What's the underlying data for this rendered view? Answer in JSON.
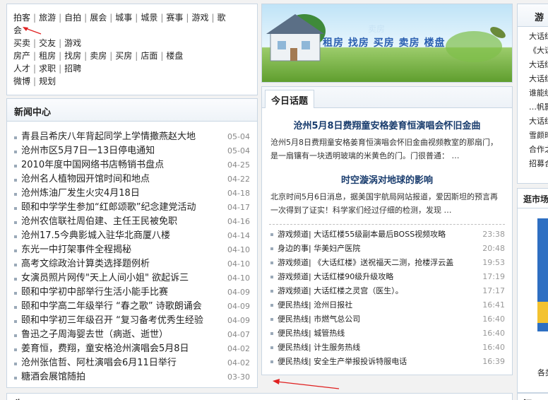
{
  "categories": {
    "row1": [
      "拍客",
      "旅游",
      "自拍",
      "展会",
      "城事",
      "城景",
      "赛事",
      "游戏",
      "歌"
    ],
    "row1b": [
      "会"
    ],
    "row2": [
      "买卖",
      "交友",
      "游戏"
    ],
    "row3": [
      "房产",
      "租房",
      "找房",
      "卖房",
      "买房",
      "店面",
      "楼盘"
    ],
    "row4": [
      "人才",
      "求职",
      "招聘"
    ],
    "row5": [
      "微博",
      "规划"
    ]
  },
  "news": {
    "title": "新闻中心",
    "items": [
      {
        "text": "青县吕希庆八年背起同学上学情撒燕赵大地",
        "date": "05-04"
      },
      {
        "text": "沧州市区5月7日一13日停电通知",
        "date": "05-04"
      },
      {
        "text": "2010年度中国网络书店畅销书盘点",
        "date": "04-25"
      },
      {
        "text": "沧州名人植物园开馆时间和地点",
        "date": "04-22"
      },
      {
        "text": "沧州炼油厂发生火灾4月18日",
        "date": "04-18"
      },
      {
        "text": "颐和中学学生参加“红郎颂歌”纪念建党活动",
        "date": "04-17"
      },
      {
        "text": "沧州农信联社周伯建、主任王民被免职",
        "date": "04-16"
      },
      {
        "text": "沧州17.5今典影城入驻华北商厦八楼",
        "date": "04-14"
      },
      {
        "text": "东光一中打架事件全程揭秘",
        "date": "04-10"
      },
      {
        "text": "高考文综政治计算类选择题例析",
        "date": "04-10"
      },
      {
        "text": "女演员照片网传\"天上人间小姐\" 欲起诉三",
        "date": "04-10"
      },
      {
        "text": "颐和中学初中部举行生活小能手比赛",
        "date": "04-09"
      },
      {
        "text": "颐和中学高二年级举行 “春之歌” 诗歌朗诵会",
        "date": "04-09"
      },
      {
        "text": "颐和中学初三年级召开 “复习备考优秀生经验",
        "date": "04-09"
      },
      {
        "text": "鲁迅之子周海婴去世（病逝、逝世）",
        "date": "04-07"
      },
      {
        "text": "姜育恒，费翔，童安格沧州演唱会5月8日",
        "date": "04-02"
      },
      {
        "text": "沧州张信哲、阿杜演唱会6月11日举行",
        "date": "04-02"
      },
      {
        "text": "糖酒会展馆随拍",
        "date": "03-30"
      }
    ]
  },
  "banner": {
    "text": "租房 找房 买房 卖房 楼盘",
    "sub": "卖房"
  },
  "today": {
    "tab": "今日话题",
    "story1_title": "沧州5月8日费翔童安格姜育恒演唱会怀旧金曲",
    "story1_body": "沧州5月8日费翔童安格姜育恒演唱会怀旧金曲视频教室的那扇门，是一扇镶有一块透明玻璃的米黄色的门。门很普通：  …",
    "story2_title": "时空漩涡对地球的影响",
    "story2_body": "北京时间5月6日消息，据美国宇航局网站报道，爱因斯坦的预言再一次得到了证实！科学家们经过仔细的检测，发现  …",
    "items": [
      {
        "text": "游戏频道| 大话红楼55级副本最后BOSS视频攻略",
        "time": "23:38"
      },
      {
        "text": "身边的事| 华美妇产医院",
        "time": "20:48"
      },
      {
        "text": "游戏频道| 《大话红楼》送祝福天二测，抢楼浮云盖",
        "time": "19:53"
      },
      {
        "text": "游戏频道| 大话红楼90级升级攻略",
        "time": "17:19"
      },
      {
        "text": "游戏频道| 大话红楼之灵宫（医生）。",
        "time": "17:17"
      },
      {
        "text": "便民热线| 沧州日报社",
        "time": "16:41"
      },
      {
        "text": "便民热线| 市燃气总公司",
        "time": "16:40"
      },
      {
        "text": "便民热线| 城管热线",
        "time": "16:40"
      },
      {
        "text": "便民热线| 计生服务热线",
        "time": "16:40"
      },
      {
        "text": "便民热线| 安全生产举报投诉特服电话",
        "time": "16:39"
      }
    ]
  },
  "right": {
    "title": "游",
    "items": [
      "大话红",
      "《大话",
      "大话红",
      "大话红",
      "谁能统",
      "…帆影",
      "大话红",
      "雪颜时",
      "合作之",
      "招募合"
    ]
  },
  "right2": {
    "title": "逛市场",
    "foot": "各类"
  },
  "bottom": {
    "left_label": "生",
    "right_label": "汉"
  },
  "colors": {
    "border": "#c9d6e3",
    "annotation": "#e02020",
    "headline": "#1a3d6e"
  }
}
